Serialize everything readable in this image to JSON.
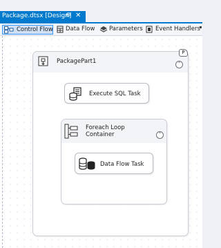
{
  "document_tab": {
    "title": "Package.dtsx [Design]",
    "pin_glyph": "⊕",
    "close_glyph": "✕"
  },
  "designer_tabs": [
    {
      "label": "Control Flow",
      "icon": "control-flow-icon",
      "active": true
    },
    {
      "label": "Data Flow",
      "icon": "data-flow-icon",
      "active": false
    },
    {
      "label": "Parameters",
      "icon": "parameters-icon",
      "active": false
    },
    {
      "label": "Event Handlers",
      "icon": "event-handlers-icon",
      "active": false
    }
  ],
  "canvas": {
    "package_part": {
      "name": "PackagePart1",
      "badge": "P",
      "collapse_glyph": "˄"
    },
    "execute_sql_task": {
      "label": "Execute SQL Task"
    },
    "foreach_container": {
      "label_line1": "Foreach Loop",
      "label_line2": "Container",
      "collapse_glyph": "˄"
    },
    "data_flow_task": {
      "label": "Data Flow Task"
    }
  },
  "colors": {
    "accent": "#007acc",
    "active_tab_fill": "#cfe0f4",
    "active_tab_border": "#3399ff"
  }
}
